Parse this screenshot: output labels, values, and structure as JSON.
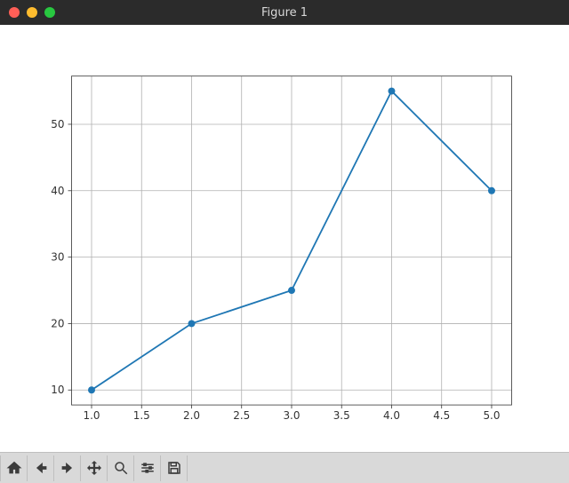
{
  "window": {
    "title": "Figure 1"
  },
  "toolbar": {
    "home": "Home",
    "back": "Back",
    "forward": "Forward",
    "pan": "Pan",
    "zoom": "Zoom",
    "configure": "Configure subplots",
    "save": "Save"
  },
  "chart_data": {
    "type": "line",
    "x": [
      1.0,
      2.0,
      3.0,
      4.0,
      5.0
    ],
    "y": [
      10,
      20,
      25,
      55,
      40
    ],
    "xticks": [
      1.0,
      1.5,
      2.0,
      2.5,
      3.0,
      3.5,
      4.0,
      4.5,
      5.0
    ],
    "yticks": [
      10,
      20,
      30,
      40,
      50
    ],
    "xlim": [
      0.8,
      5.2
    ],
    "ylim": [
      7.75,
      57.25
    ],
    "title": "",
    "xlabel": "",
    "ylabel": "",
    "grid": true,
    "line_color": "#1f77b4",
    "marker": "o"
  }
}
